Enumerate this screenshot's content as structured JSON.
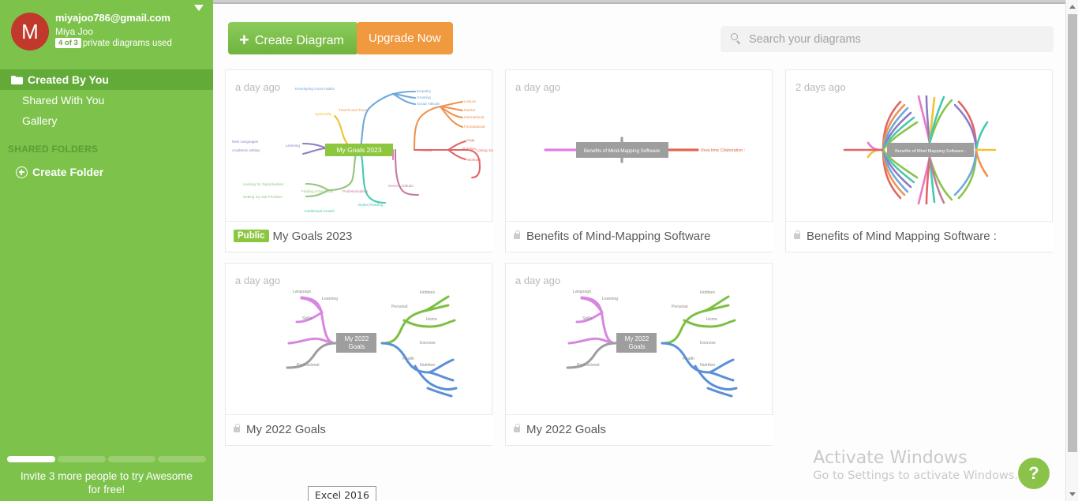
{
  "account": {
    "avatar_initial": "M",
    "email": "miyajoo786@gmail.com",
    "name": "Miya Joo",
    "usage_pill": "4 of 3",
    "usage_text": "private diagrams used"
  },
  "sidebar": {
    "nav": [
      {
        "label": "Created By You",
        "active": true,
        "icon": "folder-icon"
      },
      {
        "label": "Shared With You",
        "active": false
      },
      {
        "label": "Gallery",
        "active": false
      }
    ],
    "section_header": "SHARED FOLDERS",
    "create_folder_label": "Create Folder",
    "invite": {
      "segments": [
        true,
        false,
        false,
        false
      ],
      "text": "Invite 3 more people to try Awesome for free!"
    }
  },
  "toolbar": {
    "create_label": "Create Diagram",
    "upgrade_label": "Upgrade Now",
    "search_placeholder": "Search your diagrams",
    "search_value": ""
  },
  "cards": [
    {
      "timestamp": "a day ago",
      "title": "My Goals 2023",
      "visibility": "public",
      "badge": "Public",
      "center_node": "My Goals 2023",
      "center_color": "#8dc63f",
      "branches": [
        "Developing Good Habits",
        "Empathy",
        "Greeting",
        "Social Attitude",
        "Spirituality",
        "Travels and Tours",
        "Leisure",
        "Marital",
        "International",
        "Foundational",
        "Learning",
        "New Languages",
        "Academic writing",
        "Personal",
        "Yoga",
        "Nutrition",
        "Workout",
        "Losing Journal",
        "Looking for Opportunities",
        "Setting my Job Priorities",
        "Finding a Good Job",
        "Professionalism",
        "Service Attitude",
        "Intellectual Growth",
        "Books Reading"
      ]
    },
    {
      "timestamp": "a day ago",
      "title": "Benefits of Mind-Mapping Software",
      "visibility": "private",
      "badge": "",
      "center_node": "Benefits of Mind-Mapping Software",
      "center_color": "#9e9e9e",
      "branches": [
        "Real-time Cllaboration :"
      ]
    },
    {
      "timestamp": "2 days ago",
      "title": "Benefits of Mind Mapping Software :",
      "visibility": "private",
      "badge": "",
      "center_node": "Benefits of Mind Mapping Software :",
      "center_color": "#9e9e9e",
      "branches": []
    },
    {
      "timestamp": "a day ago",
      "title": "My 2022 Goals",
      "visibility": "private",
      "badge": "",
      "center_node": "My 2022 Goals",
      "center_color": "#9e9e9e",
      "branches": [
        "Language",
        "Learning",
        "Skills",
        "Professional",
        "Personal",
        "Hobbies",
        "Home",
        "Health",
        "Exercise",
        "Nutrition"
      ]
    },
    {
      "timestamp": "a day ago",
      "title": "My 2022 Goals",
      "visibility": "private",
      "badge": "",
      "center_node": "My 2022 Goals",
      "center_color": "#9e9e9e",
      "branches": [
        "Language",
        "Learning",
        "Skills",
        "Professional",
        "Personal",
        "Hobbies",
        "Home",
        "Health",
        "Exercise",
        "Nutrition"
      ]
    }
  ],
  "watermark": {
    "line1": "Activate Windows",
    "line2": "Go to Settings to activate Windows."
  },
  "help_button_label": "?",
  "taskbar_tooltip": "Excel 2016",
  "colors": {
    "sidebar_green": "#7dc24b",
    "active_green": "#63ab39",
    "create_green": "#6fb33c",
    "upgrade_orange": "#f0993e",
    "avatar_red": "#c0392b"
  }
}
